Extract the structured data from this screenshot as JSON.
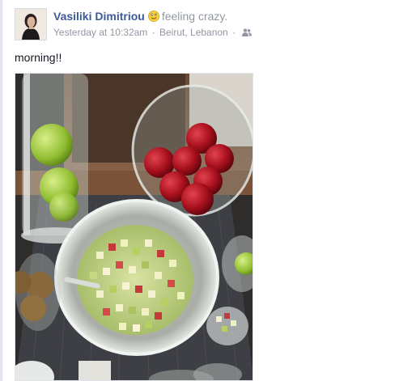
{
  "post": {
    "author": "Vasiliki Dimitriou",
    "feeling": "feeling crazy.",
    "feeling_icon": "crazy-face-emoji",
    "timestamp": "Yesterday at 10:32am",
    "separator": "·",
    "location": "Beirut, Lebanon",
    "audience_icon": "friends-icon",
    "text": "morning!!",
    "photo_icon": "breakfast-buffet-photo"
  },
  "colors": {
    "link": "#3b5998",
    "meta": "#9197a3",
    "text": "#141823"
  }
}
